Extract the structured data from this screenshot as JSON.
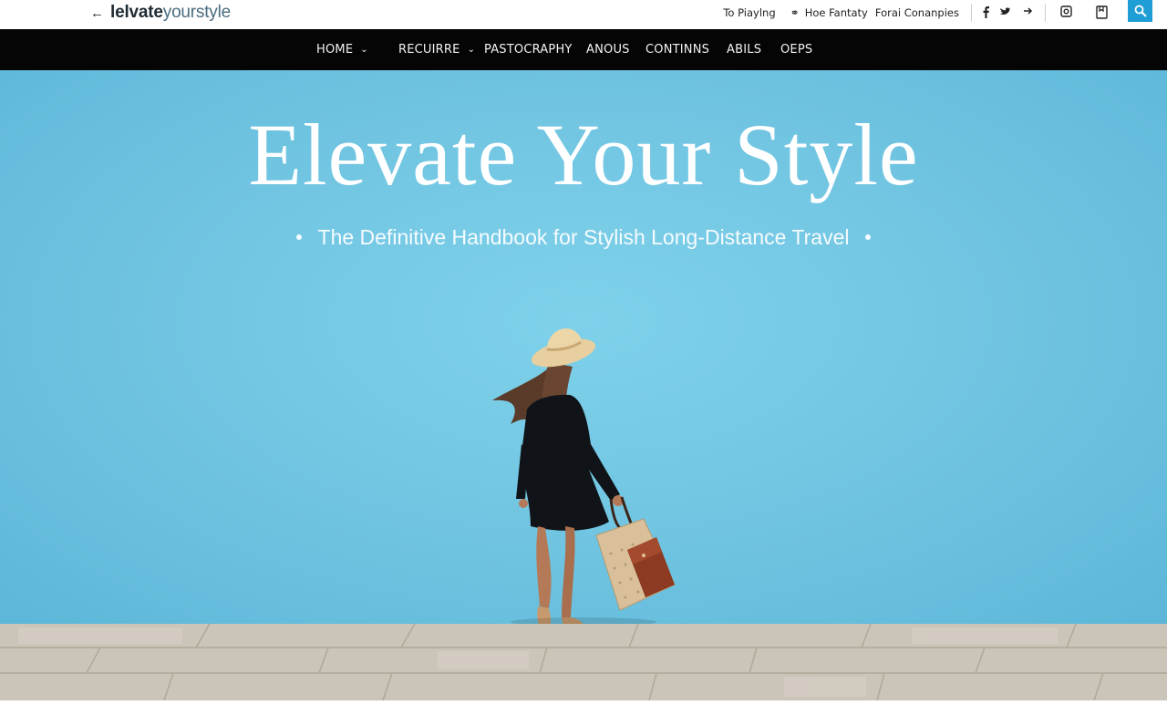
{
  "header": {
    "logo_bold": "lelvate",
    "logo_light": "yourstyle",
    "utility_links": [
      "To Piaylng",
      "Hoe Fantaty",
      "Forai Conanpies"
    ]
  },
  "nav": {
    "items": [
      {
        "label": "HOME",
        "has_dropdown": true
      },
      {
        "label": "RECUIRRE",
        "has_dropdown": true
      },
      {
        "label": "PASTOCRAPHY",
        "has_dropdown": false
      },
      {
        "label": "ANOUS",
        "has_dropdown": false
      },
      {
        "label": "CONTINNS",
        "has_dropdown": false
      },
      {
        "label": "ABILS",
        "has_dropdown": false
      },
      {
        "label": "OEPS",
        "has_dropdown": false
      }
    ]
  },
  "hero": {
    "title": "Elevate Your Style",
    "subtitle": "The Definitive Handbook for Stylish Long-Distance Travel"
  },
  "colors": {
    "sky": "#72c6e2",
    "nav_bg": "#050505",
    "search_blue": "#1f9ed6",
    "pavement": "#cbc4b8"
  }
}
